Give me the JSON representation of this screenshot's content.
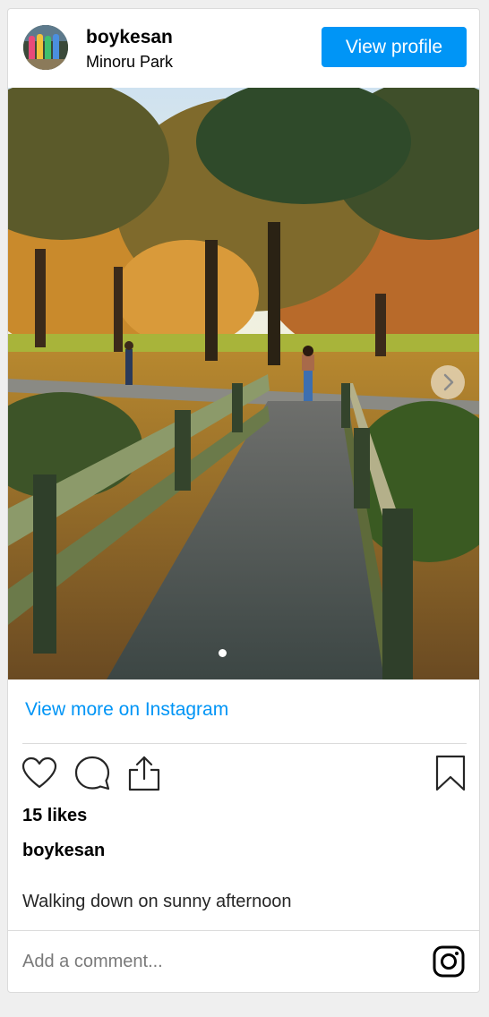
{
  "header": {
    "username": "boykesan",
    "location": "Minoru Park",
    "view_profile_label": "View profile"
  },
  "post": {
    "image_description": "",
    "carousel_position": 1
  },
  "links": {
    "view_more_label": "View more on Instagram"
  },
  "actions": {
    "like_icon": "heart-icon",
    "comment_icon": "comment-icon",
    "share_icon": "share-icon",
    "save_icon": "bookmark-icon"
  },
  "likes_label": "15 likes",
  "caption": {
    "username": "boykesan",
    "text": "Walking down on sunny afternoon"
  },
  "comment": {
    "placeholder": "Add a comment..."
  },
  "colors": {
    "accent": "#0095f6",
    "border": "#dbdbdb",
    "background": "#efefef"
  }
}
